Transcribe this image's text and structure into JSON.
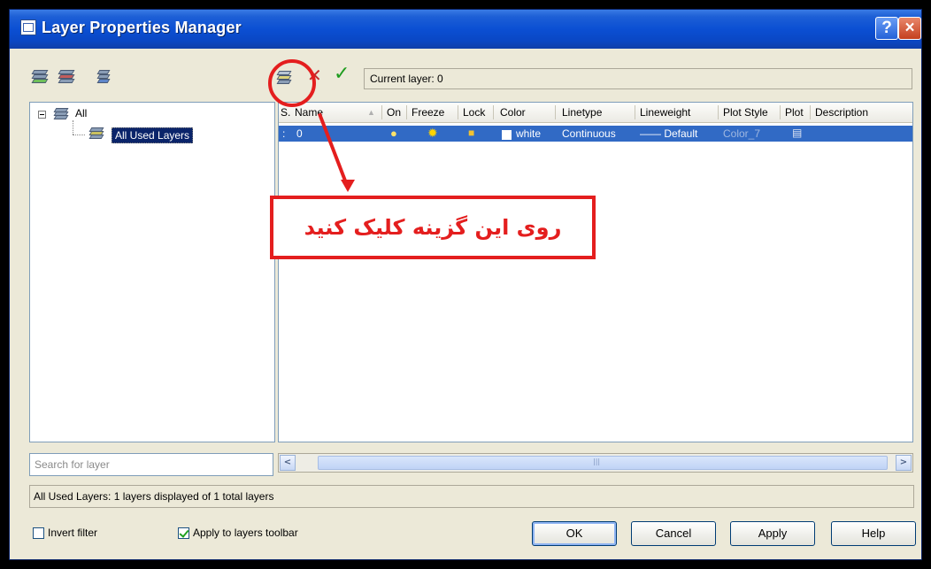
{
  "window": {
    "title": "Layer Properties Manager",
    "help_label": "?",
    "close_label": "×"
  },
  "toolbar": {
    "current_layer": "Current layer: 0",
    "delete_icon": "✕",
    "set_current_icon": "✓"
  },
  "tree": {
    "root": "All",
    "child": "All Used Layers"
  },
  "search": {
    "placeholder": "Search for layer"
  },
  "grid": {
    "columns": [
      "S.",
      "Name",
      "On",
      "Freeze",
      "Lock",
      "Color",
      "Linetype",
      "Lineweight",
      "Plot Style",
      "Plot",
      "Description"
    ],
    "row": {
      "status": ":",
      "name": "0",
      "color": "white",
      "linetype": "Continuous",
      "lineweight": "—— Default",
      "plot_style": "Color_7"
    }
  },
  "scrollbar": {
    "left": "<",
    "right": ">",
    "grip": "|||"
  },
  "status_bar": {
    "text": "All Used Layers: 1 layers displayed of 1 total layers"
  },
  "options": {
    "invert_filter": "Invert filter",
    "apply_toolbar": "Apply to layers toolbar"
  },
  "buttons": {
    "ok": "OK",
    "cancel": "Cancel",
    "apply": "Apply",
    "help": "Help"
  },
  "annotation": {
    "text": "روی این گزینه کلیک کنید",
    "color": "#e41e1e"
  }
}
